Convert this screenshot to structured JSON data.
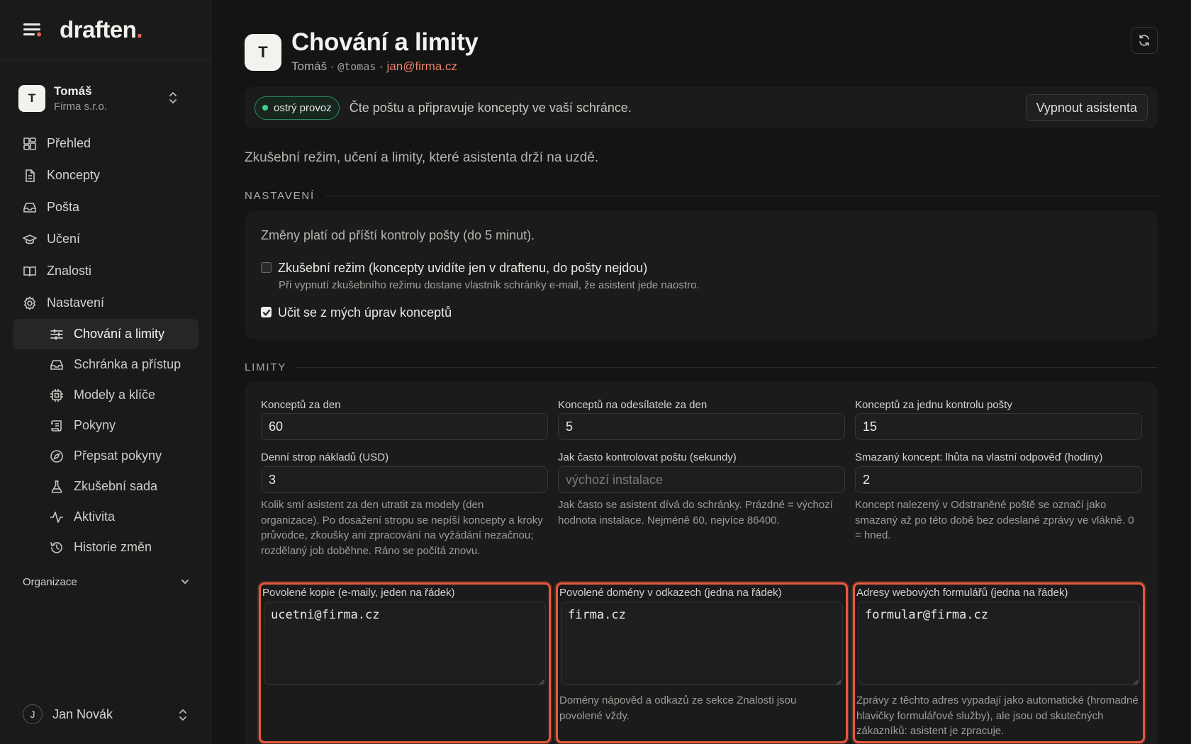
{
  "brand": {
    "name": "draften",
    "dot": "."
  },
  "org": {
    "initial": "T",
    "name": "Tomáš",
    "sub": "Firma s.r.o."
  },
  "nav": {
    "overview": "Přehled",
    "drafts": "Koncepty",
    "mail": "Pošta",
    "learning": "Učení",
    "knowledge": "Znalosti",
    "settings": "Nastavení",
    "sub": {
      "behavior": "Chování a limity",
      "mailbox": "Schránka a přístup",
      "models": "Modely a klíče",
      "instructions": "Pokyny",
      "rewrite": "Přepsat pokyny",
      "testset": "Zkušební sada",
      "activity": "Aktivita",
      "history": "Historie změn"
    }
  },
  "organizations_label": "Organizace",
  "user": {
    "initial": "J",
    "name": "Jan Novák"
  },
  "header": {
    "avatar": "T",
    "title": "Chování a limity",
    "name": "Tomáš",
    "sep": "·",
    "handle": "@tomas",
    "email": "jan@firma.cz"
  },
  "status": {
    "badge": "ostrý provoz",
    "text": "Čte poštu a připravuje koncepty ve vaší schránce.",
    "off_button": "Vypnout asistenta"
  },
  "intro": "Zkušební režim, učení a limity, které asistenta drží na uzdě.",
  "settings": {
    "heading": "NASTAVENÍ",
    "note": "Změny platí od příští kontroly pošty (do 5 minut).",
    "trial_label": "Zkušební režim (koncepty uvidíte jen v draftenu, do pošty nejdou)",
    "trial_checked": false,
    "trial_help": "Při vypnutí zkušebního režimu dostane vlastník schránky e-mail, že asistent jede naostro.",
    "learn_label": "Učit se z mých úprav konceptů",
    "learn_checked": true
  },
  "limits": {
    "heading": "LIMITY",
    "per_day": {
      "label": "Konceptů za den",
      "value": "60"
    },
    "per_sender": {
      "label": "Konceptů na odesílatele za den",
      "value": "5"
    },
    "per_check": {
      "label": "Konceptů za jednu kontrolu pošty",
      "value": "15"
    },
    "cost_cap": {
      "label": "Denní strop nákladů (USD)",
      "value": "3",
      "help": "Kolik smí asistent za den utratit za modely (den organizace). Po dosažení stropu se nepíší koncepty a kroky průvodce, zkoušky ani zpracování na vyžádání nezačnou; rozdělaný job doběhne. Ráno se počítá znovu."
    },
    "poll": {
      "label": "Jak často kontrolovat poštu (sekundy)",
      "placeholder": "výchozí instalace",
      "help": "Jak často se asistent dívá do schránky. Prázdné = výchozí hodnota instalace. Nejméně 60, nejvíce 86400."
    },
    "deleted": {
      "label": "Smazaný koncept: lhůta na vlastní odpověď (hodiny)",
      "value": "2",
      "help": "Koncept nalezený v Odstraněné poště se označí jako smazaný až po této době bez odeslané zprávy ve vlákně. 0 = hned."
    },
    "cc": {
      "label": "Povolené kopie (e-maily, jeden na řádek)",
      "value": "ucetni@firma.cz"
    },
    "domains": {
      "label": "Povolené domény v odkazech (jedna na řádek)",
      "value": "firma.cz",
      "help": "Domény nápověd a odkazů ze sekce Znalosti jsou povolené vždy."
    },
    "forms": {
      "label": "Adresy webových formulářů (jedna na řádek)",
      "value": "formular@firma.cz",
      "help": "Zprávy z těchto adres vypadají jako automatické (hromadné hlavičky formulářové služby), ale jsou od skutečných zákazníků: asistent je zpracuje."
    }
  },
  "colors": {
    "accent": "#e5654f",
    "highlight": "#e55a40",
    "status_green": "#3dd28d",
    "background": "#141414"
  }
}
